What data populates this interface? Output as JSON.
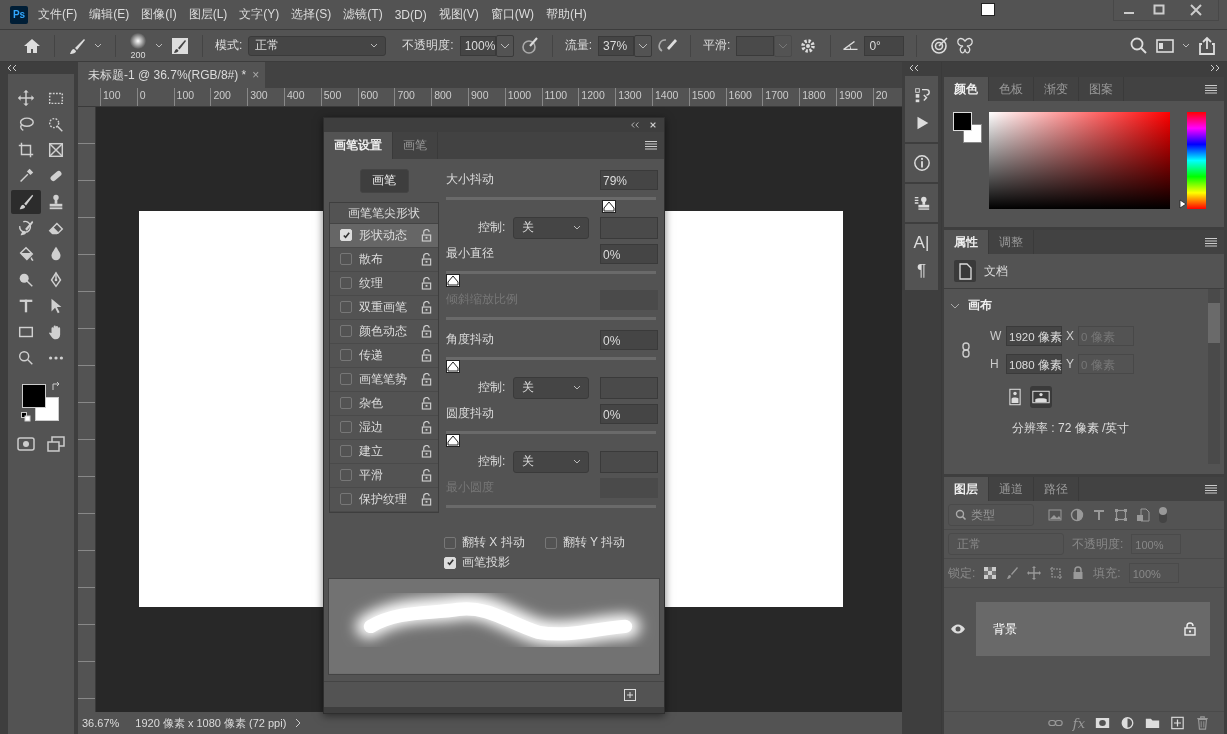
{
  "app": {
    "logo": "Ps"
  },
  "menu": [
    "文件(F)",
    "编辑(E)",
    "图像(I)",
    "图层(L)",
    "文字(Y)",
    "选择(S)",
    "滤镜(T)",
    "3D(D)",
    "视图(V)",
    "窗口(W)",
    "帮助(H)"
  ],
  "options_bar": {
    "brush_size": "200",
    "mode_label": "模式:",
    "mode": "正常",
    "opacity_label": "不透明度:",
    "opacity": "100%",
    "flow_label": "流量:",
    "flow": "37%",
    "smoothing_label": "平滑:",
    "angle": "0°"
  },
  "tools": [
    {
      "selected": false
    },
    {
      "selected": false
    },
    {
      "selected": false
    },
    {
      "selected": false
    },
    {
      "selected": false
    },
    {
      "selected": false
    },
    {
      "selected": false
    },
    {
      "selected": false
    },
    {
      "selected": true
    },
    {
      "selected": false
    },
    {
      "selected": false
    },
    {
      "selected": false
    },
    {
      "selected": false
    },
    {
      "selected": false
    },
    {
      "selected": false
    },
    {
      "selected": false
    },
    {
      "selected": false
    },
    {
      "selected": false
    },
    {
      "selected": false
    },
    {
      "selected": false
    },
    {
      "selected": false
    },
    {
      "selected": false
    }
  ],
  "document": {
    "tab_title": "未标题-1 @ 36.7%(RGB/8#) *",
    "tab_close": "×",
    "ruler_labels": [
      "100",
      "0",
      "100",
      "200",
      "300",
      "400",
      "500",
      "600",
      "700",
      "800",
      "900",
      "1000",
      "1100",
      "1200",
      "1300",
      "1400",
      "1500",
      "1600",
      "1700",
      "1800",
      "1900",
      "20"
    ],
    "status_zoom": "36.67%",
    "status_info": "1920 像素 x 1080 像素 (72 ppi)"
  },
  "brush_panel": {
    "tabs": [
      {
        "label": "画笔设置",
        "selected": true
      },
      {
        "label": "画笔",
        "selected": false
      }
    ],
    "brushes_button": "画笔",
    "tip_shape": "画笔笔尖形状",
    "options": [
      {
        "label": "形状动态",
        "checked": true,
        "selected": true
      },
      {
        "label": "散布",
        "checked": false,
        "selected": false
      },
      {
        "label": "纹理",
        "checked": false,
        "selected": false
      },
      {
        "label": "双重画笔",
        "checked": false,
        "selected": false
      },
      {
        "label": "颜色动态",
        "checked": false,
        "selected": false
      },
      {
        "label": "传递",
        "checked": false,
        "selected": false
      },
      {
        "label": "画笔笔势",
        "checked": false,
        "selected": false
      },
      {
        "label": "杂色",
        "checked": false,
        "selected": false
      },
      {
        "label": "湿边",
        "checked": false,
        "selected": false
      },
      {
        "label": "建立",
        "checked": false,
        "selected": false
      },
      {
        "label": "平滑",
        "checked": false,
        "selected": false
      },
      {
        "label": "保护纹理",
        "checked": false,
        "selected": false
      }
    ],
    "settings": [
      {
        "kind": "slider",
        "label": "大小抖动",
        "value": "79%",
        "level": 0.79,
        "disabled": false
      },
      {
        "kind": "control",
        "label": "控制:",
        "value": "关"
      },
      {
        "kind": "slider",
        "label": "最小直径",
        "value": "0%",
        "level": 0,
        "disabled": false
      },
      {
        "kind": "slider",
        "label": "倾斜缩放比例",
        "disabled": true
      },
      {
        "kind": "slider",
        "label": "角度抖动",
        "value": "0%",
        "level": 0,
        "disabled": false
      },
      {
        "kind": "control",
        "label": "控制:",
        "value": "关"
      },
      {
        "kind": "slider",
        "label": "圆度抖动",
        "value": "0%",
        "level": 0,
        "disabled": false
      },
      {
        "kind": "control",
        "label": "控制:",
        "value": "关"
      },
      {
        "kind": "slider",
        "label": "最小圆度",
        "disabled": true
      }
    ],
    "flips": [
      {
        "label": "翻转 X 抖动",
        "checked": false
      },
      {
        "label": "翻转 Y 抖动",
        "checked": false
      }
    ],
    "projection": {
      "label": "画笔投影",
      "checked": true
    }
  },
  "side_strip": {
    "character_glyph": "A|",
    "paragraph_glyph": "¶"
  },
  "color_panel": {
    "tabs": [
      {
        "label": "颜色",
        "selected": true
      },
      {
        "label": "色板",
        "selected": false
      },
      {
        "label": "渐变",
        "selected": false
      },
      {
        "label": "图案",
        "selected": false
      }
    ],
    "hue_slider": {
      "level": 0
    }
  },
  "properties_panel": {
    "tabs": [
      {
        "label": "属性",
        "selected": true
      },
      {
        "label": "调整",
        "selected": false
      }
    ],
    "kind_label": "文档",
    "section": "画布",
    "expanded": true,
    "fields": [
      {
        "label": "W",
        "value": "1920 像素",
        "disabled": false
      },
      {
        "label": "X",
        "value": "0 像素",
        "disabled": true
      },
      {
        "label": "H",
        "value": "1080 像素",
        "disabled": false
      },
      {
        "label": "Y",
        "value": "0 像素",
        "disabled": true
      }
    ],
    "orientation": [
      {
        "selected": false
      },
      {
        "selected": true
      }
    ],
    "resolution": "分辨率 : 72 像素 /英寸"
  },
  "layers_panel": {
    "tabs": [
      {
        "label": "图层",
        "selected": true
      },
      {
        "label": "通道",
        "selected": false
      },
      {
        "label": "路径",
        "selected": false
      }
    ],
    "filter": "类型",
    "blend_mode": "正常",
    "opacity_label": "不透明度:",
    "opacity": "100%",
    "lock_label": "锁定:",
    "fill_label": "填充:",
    "fill": "100%",
    "layers": [
      {
        "name": "背景",
        "visible": true,
        "locked": true,
        "selected": true
      }
    ],
    "fx": "fx"
  }
}
